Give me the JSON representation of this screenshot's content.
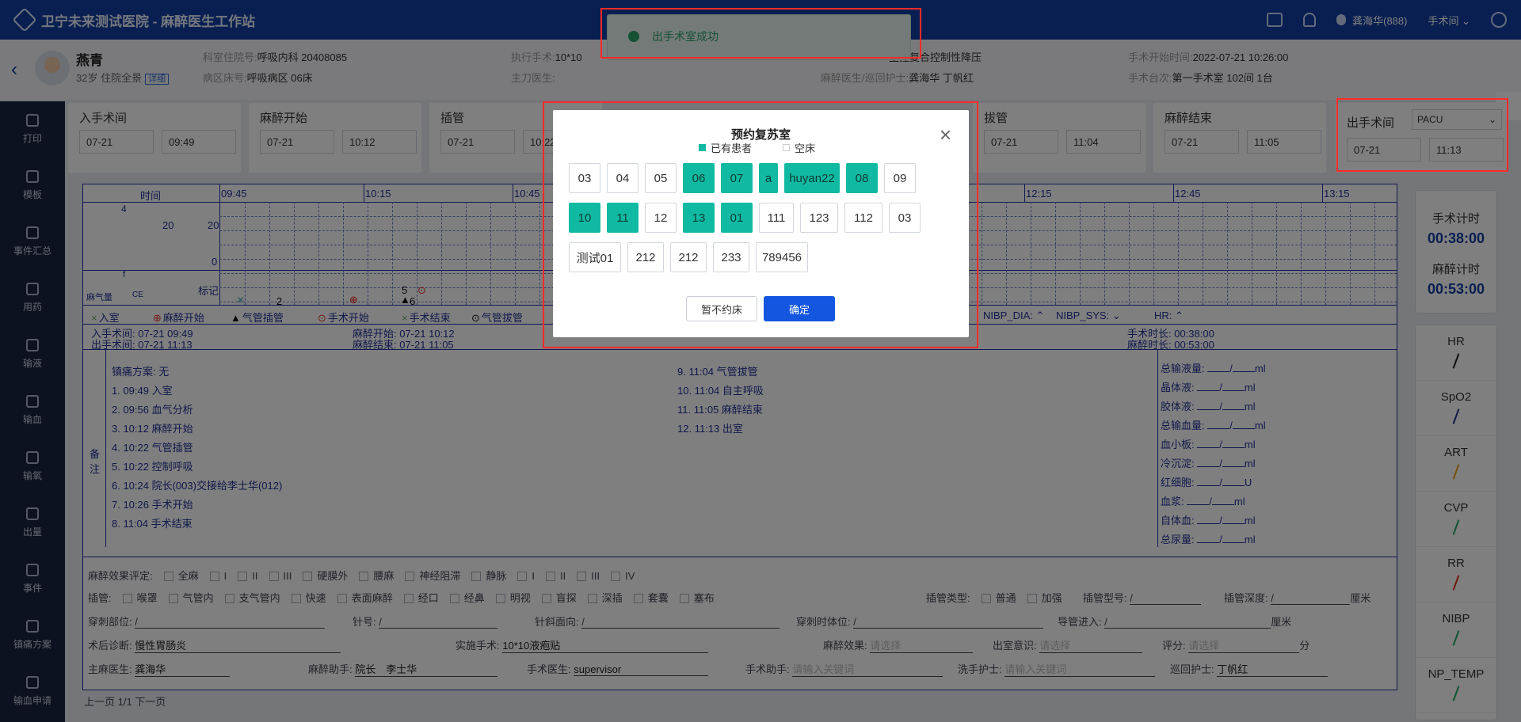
{
  "app": {
    "title": "卫宁未来测试医院 - 麻醉医生工作站",
    "user": "龚海华(888)",
    "room_menu": "手术间"
  },
  "toast": {
    "text": "出手术室成功"
  },
  "patient": {
    "name": "燕青",
    "age": "32岁",
    "status": "住院全景",
    "detail_tag": "详细",
    "fields": [
      {
        "label": "科室住院号:",
        "value": "呼吸内科 20408085"
      },
      {
        "label": "病区床号:",
        "value": "呼吸病区 06床"
      },
      {
        "label": "执行手术:",
        "value": "10*10"
      },
      {
        "label": "主刀医生:",
        "value": ""
      },
      {
        "label": "",
        "value": "主控复合控制性降压"
      },
      {
        "label": "麻醉医生/巡回护士:",
        "value": "龚海华 丁帆红"
      },
      {
        "label": "手术开始时间:",
        "value": "2022-07-21 10:26:00"
      },
      {
        "label": "手术台次:",
        "value": "第一手术室 102间 1台"
      }
    ]
  },
  "nav": [
    {
      "label": "打印",
      "icon": "printer-icon"
    },
    {
      "label": "模板",
      "icon": "template-icon"
    },
    {
      "label": "事件汇总",
      "icon": "chart-icon"
    },
    {
      "label": "用药",
      "icon": "pill-icon"
    },
    {
      "label": "输液",
      "icon": "infusion-icon"
    },
    {
      "label": "输血",
      "icon": "blood-drop-icon"
    },
    {
      "label": "输氧",
      "icon": "oxygen-icon"
    },
    {
      "label": "出量",
      "icon": "output-icon"
    },
    {
      "label": "事件",
      "icon": "event-icon"
    },
    {
      "label": "镇痛方案",
      "icon": "analgesia-icon"
    },
    {
      "label": "输血申请",
      "icon": "blood-request-icon"
    }
  ],
  "time_cards": [
    {
      "label": "入手术间",
      "date": "07-21",
      "time": "09:49"
    },
    {
      "label": "麻醉开始",
      "date": "07-21",
      "time": "10:12"
    },
    {
      "label": "插管",
      "date": "07-21",
      "time": "10:22"
    },
    {
      "label": "拔管",
      "date": "07-21",
      "time": "11:04"
    },
    {
      "label": "麻醉结束",
      "date": "07-21",
      "time": "11:05"
    },
    {
      "label": "出手术间",
      "date": "07-21",
      "time": "11:13",
      "select": "PACU"
    }
  ],
  "record": {
    "time_label": "时间",
    "times": [
      "09:45",
      "10:15",
      "10:45",
      "12:15",
      "12:45",
      "13:15"
    ],
    "axis": {
      "a": "4",
      "b": "20",
      "c": "20",
      "d": "0",
      "e": "f",
      "f": "CE",
      "g": "麻气量",
      "h": "标记"
    },
    "marks": {
      "m2": "2",
      "m5": "5",
      "m6": "6"
    },
    "legend": [
      "入室",
      "麻醉开始",
      "气管插管",
      "手术开始",
      "手术结束",
      "气管拔管"
    ],
    "vital_toggles": [
      "NIBP_DIA:",
      "NIBP_SYS:",
      "HR:"
    ],
    "summary": [
      "入手术间: 07-21 09:49",
      "出手术间: 07-21 11:13",
      "麻醉开始: 07-21 10:12",
      "麻醉结束: 07-21 11:05",
      "插管: 07-21 10:22",
      "拔管: 07-21 11:04",
      "手术开始: 07-21 10:26",
      "手术结束: 07-21 11:04",
      "手术时长: 00:38:00",
      "麻醉时长: 00:53:00"
    ],
    "remark_label": "备注",
    "events_left": [
      "镇痛方案: 无",
      "1. 09:49 入室",
      "2. 09:56 血气分析",
      "3. 10:12 麻醉开始",
      "4. 10:22 气管插管",
      "5. 10:22 控制呼吸",
      "6. 10:24 院长(003)交接给李士华(012)",
      "7. 10:26 手术开始",
      "8. 11:04 手术结束"
    ],
    "events_right": [
      "9. 11:04 气管拔管",
      "10. 11:04 自主呼吸",
      "11. 11:05 麻醉结束",
      "12. 11:13 出室"
    ],
    "fluids": [
      {
        "label": "总输液量:",
        "unit": "ml"
      },
      {
        "label": "晶体液:",
        "unit": "ml"
      },
      {
        "label": "胶体液:",
        "unit": "ml"
      },
      {
        "label": "总输血量:",
        "unit": "ml"
      },
      {
        "label": "血小板:",
        "unit": "ml"
      },
      {
        "label": "冷沉淀:",
        "unit": "ml"
      },
      {
        "label": "红细胞:",
        "unit": "U"
      },
      {
        "label": "血浆:",
        "unit": "ml"
      },
      {
        "label": "自体血:",
        "unit": "ml"
      },
      {
        "label": "总尿量:",
        "unit": "ml"
      }
    ],
    "effect_label": "麻醉效果评定:",
    "effect_opts": [
      "全麻",
      "I",
      "II",
      "III",
      "硬膜外",
      "腰麻",
      "神经阻滞",
      "静脉",
      "I",
      "II",
      "III",
      "IV"
    ],
    "intub_label": "插管:",
    "intub_opts": [
      "喉罩",
      "气管内",
      "支气管内",
      "快速",
      "表面麻醉",
      "经口",
      "经鼻",
      "明视",
      "盲探",
      "深插",
      "套囊",
      "塞布"
    ],
    "intub_type": "插管类型:",
    "intub_type_opts": [
      "普通",
      "加强"
    ],
    "tube_model": "插管型号:",
    "tube_depth": "插管深度:",
    "cm": "厘米",
    "puncture": "穿刺部位:",
    "needle": "针号:",
    "bevel": "针斜面向:",
    "position": "穿刺时体位:",
    "catheter": "导管进入:",
    "diag_label": "术后诊断:",
    "diag_value": "慢性胃肠炎",
    "op_label": "实施手术:",
    "op_value": "10*10液疱贴",
    "effect2_label": "麻醉效果:",
    "effect2_ph": "请选择",
    "conscious_label": "出室意识:",
    "conscious_ph": "请选择",
    "score_label": "评分:",
    "score_ph": "请选择",
    "score_unit": "分",
    "main_doc_label": "主麻医生:",
    "main_doc": "龚海华",
    "assist_label": "麻醉助手:",
    "assist1": "院长",
    "assist2": "李士华",
    "surgeon_label": "手术医生:",
    "surgeon": "supervisor",
    "op_assist_label": "手术助手:",
    "op_assist_ph": "请输入关键词",
    "scrub_label": "洗手护士:",
    "scrub_ph": "请输入关键词",
    "circ_label": "巡回护士:",
    "circ": "丁帆红"
  },
  "pager": "上一页 1/1 下一页",
  "timers": {
    "op_label": "手术计时",
    "op_value": "00:38:00",
    "anes_label": "麻醉计时",
    "anes_value": "00:53:00"
  },
  "vitals": [
    {
      "name": "HR",
      "color": "#222222"
    },
    {
      "name": "SpO2",
      "color": "#223388"
    },
    {
      "name": "ART",
      "color": "#e8a020"
    },
    {
      "name": "CVP",
      "color": "#22aa66"
    },
    {
      "name": "RR",
      "color": "#dd3322"
    },
    {
      "name": "NIBP",
      "color": "#22aa66"
    },
    {
      "name": "NP_TEMP",
      "color": "#22aa66"
    }
  ],
  "modal": {
    "title": "预约复苏室",
    "legend_occ": "已有患者",
    "legend_free": "空床",
    "occ_color": "#10b9a2",
    "beds": [
      [
        {
          "n": "03",
          "o": false
        },
        {
          "n": "04",
          "o": false
        },
        {
          "n": "05",
          "o": false
        },
        {
          "n": "06",
          "o": true
        },
        {
          "n": "07",
          "o": true
        },
        {
          "n": "a",
          "o": true
        },
        {
          "n": "huyan22",
          "o": true
        },
        {
          "n": "08",
          "o": true
        },
        {
          "n": "09",
          "o": false
        }
      ],
      [
        {
          "n": "10",
          "o": true
        },
        {
          "n": "11",
          "o": true
        },
        {
          "n": "12",
          "o": false
        },
        {
          "n": "13",
          "o": true
        },
        {
          "n": "01",
          "o": true
        },
        {
          "n": "111",
          "o": false
        },
        {
          "n": "123",
          "o": false
        },
        {
          "n": "112",
          "o": false
        },
        {
          "n": "03",
          "o": false
        }
      ],
      [
        {
          "n": "测试01",
          "o": false
        },
        {
          "n": "212",
          "o": false
        },
        {
          "n": "212",
          "o": false
        },
        {
          "n": "233",
          "o": false
        },
        {
          "n": "789456",
          "o": false
        }
      ]
    ],
    "cancel": "暂不约床",
    "confirm": "确定"
  }
}
